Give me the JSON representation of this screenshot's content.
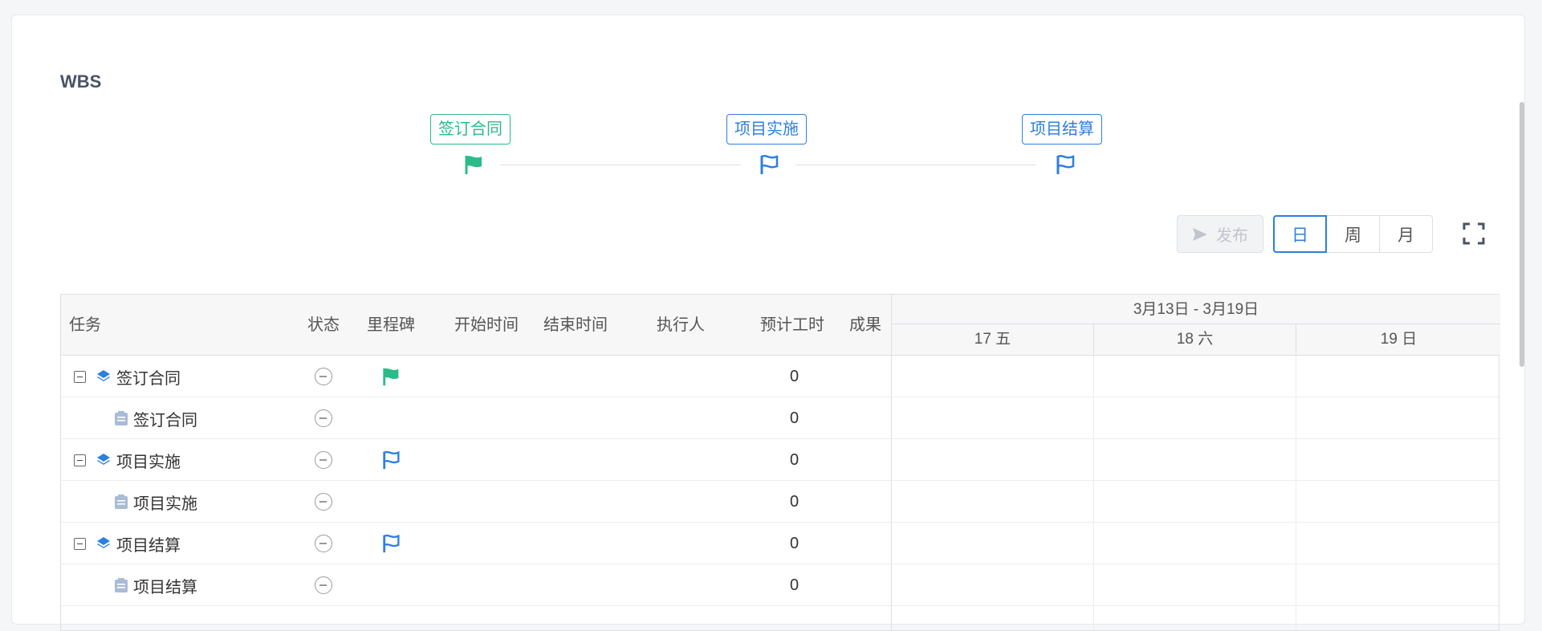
{
  "page": {
    "title": "WBS"
  },
  "milestones": [
    {
      "label": "签订合同",
      "status": "done",
      "color": "#2bbb88"
    },
    {
      "label": "项目实施",
      "status": "pending",
      "color": "#2d7fe0"
    },
    {
      "label": "项目结算",
      "status": "pending",
      "color": "#2d7fe0"
    }
  ],
  "toolbar": {
    "publish_label": "发布",
    "view_modes": [
      "日",
      "周",
      "月"
    ],
    "active_view": "日"
  },
  "table": {
    "columns": [
      "任务",
      "状态",
      "里程碑",
      "开始时间",
      "结束时间",
      "执行人",
      "预计工时",
      "成果"
    ],
    "gantt_week": "3月13日 - 3月19日",
    "gantt_days": [
      "17 五",
      "18 六",
      "19 日"
    ],
    "rows": [
      {
        "task": "签订合同",
        "level": 0,
        "type": "group",
        "milestone": "done",
        "hours": "0"
      },
      {
        "task": "签订合同",
        "level": 1,
        "type": "task",
        "milestone": "",
        "hours": "0"
      },
      {
        "task": "项目实施",
        "level": 0,
        "type": "group",
        "milestone": "pending",
        "hours": "0"
      },
      {
        "task": "项目实施",
        "level": 1,
        "type": "task",
        "milestone": "",
        "hours": "0"
      },
      {
        "task": "项目结算",
        "level": 0,
        "type": "group",
        "milestone": "pending",
        "hours": "0"
      },
      {
        "task": "项目结算",
        "level": 1,
        "type": "task",
        "milestone": "",
        "hours": "0"
      }
    ]
  },
  "colors": {
    "accent": "#2d7fe0",
    "success": "#2bbb88",
    "task_icon": "#a9bcd6"
  }
}
